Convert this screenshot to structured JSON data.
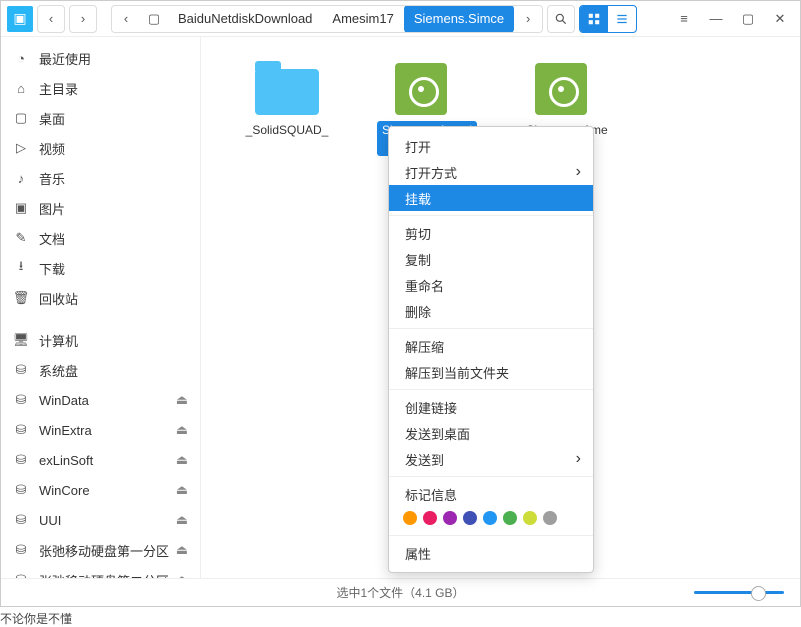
{
  "toolbar": {
    "breadcrumbs": [
      "BaiduNetdiskDownload",
      "Amesim17",
      "Siemens.Simce"
    ]
  },
  "sidebar": {
    "items": [
      {
        "label": "最近使用",
        "icon": "clock",
        "eject": false
      },
      {
        "label": "主目录",
        "icon": "home",
        "eject": false
      },
      {
        "label": "桌面",
        "icon": "desktop",
        "eject": false
      },
      {
        "label": "视频",
        "icon": "video",
        "eject": false
      },
      {
        "label": "音乐",
        "icon": "music",
        "eject": false
      },
      {
        "label": "图片",
        "icon": "image",
        "eject": false
      },
      {
        "label": "文档",
        "icon": "doc",
        "eject": false
      },
      {
        "label": "下载",
        "icon": "download",
        "eject": false
      },
      {
        "label": "回收站",
        "icon": "trash",
        "eject": false
      },
      {
        "label": "计算机",
        "icon": "computer",
        "eject": false,
        "section": true
      },
      {
        "label": "系统盘",
        "icon": "disk",
        "eject": false
      },
      {
        "label": "WinData",
        "icon": "disk",
        "eject": true
      },
      {
        "label": "WinExtra",
        "icon": "disk",
        "eject": true
      },
      {
        "label": "exLinSoft",
        "icon": "disk",
        "eject": true
      },
      {
        "label": "WinCore",
        "icon": "disk",
        "eject": true
      },
      {
        "label": "UUI",
        "icon": "disk",
        "eject": true
      },
      {
        "label": "张弛移动硬盘第一分区",
        "icon": "disk",
        "eject": true
      },
      {
        "label": "张弛移动硬盘第二分区",
        "icon": "disk",
        "eject": true
      }
    ]
  },
  "files": [
    {
      "name": "_SolidSQUAD_",
      "type": "folder",
      "selected": false
    },
    {
      "name": "Simcenter.Amesim.17.0.DVD",
      "type": "disc",
      "selected": true
    },
    {
      "name": "Simcenter Ame",
      "type": "disc",
      "selected": false
    }
  ],
  "context_menu": {
    "items": [
      {
        "label": "打开",
        "sub": false
      },
      {
        "label": "打开方式",
        "sub": true
      },
      {
        "label": "挂载",
        "sub": false,
        "highlight": true
      },
      {
        "sep": true
      },
      {
        "label": "剪切",
        "sub": false
      },
      {
        "label": "复制",
        "sub": false
      },
      {
        "label": "重命名",
        "sub": false
      },
      {
        "label": "删除",
        "sub": false
      },
      {
        "sep": true
      },
      {
        "label": "解压缩",
        "sub": false
      },
      {
        "label": "解压到当前文件夹",
        "sub": false
      },
      {
        "sep": true
      },
      {
        "label": "创建链接",
        "sub": false
      },
      {
        "label": "发送到桌面",
        "sub": false
      },
      {
        "label": "发送到",
        "sub": true
      },
      {
        "sep": true
      },
      {
        "label": "标记信息",
        "sub": false,
        "header": true
      },
      {
        "tags": [
          "#ff9800",
          "#e91e63",
          "#9c27b0",
          "#3f51b5",
          "#2196f3",
          "#4caf50",
          "#cddc39",
          "#9e9e9e"
        ]
      },
      {
        "sep": true
      },
      {
        "label": "属性",
        "sub": false
      }
    ]
  },
  "status": {
    "text": "选中1个文件（4.1 GB）"
  },
  "truncated_hint": "不论你是不懂"
}
